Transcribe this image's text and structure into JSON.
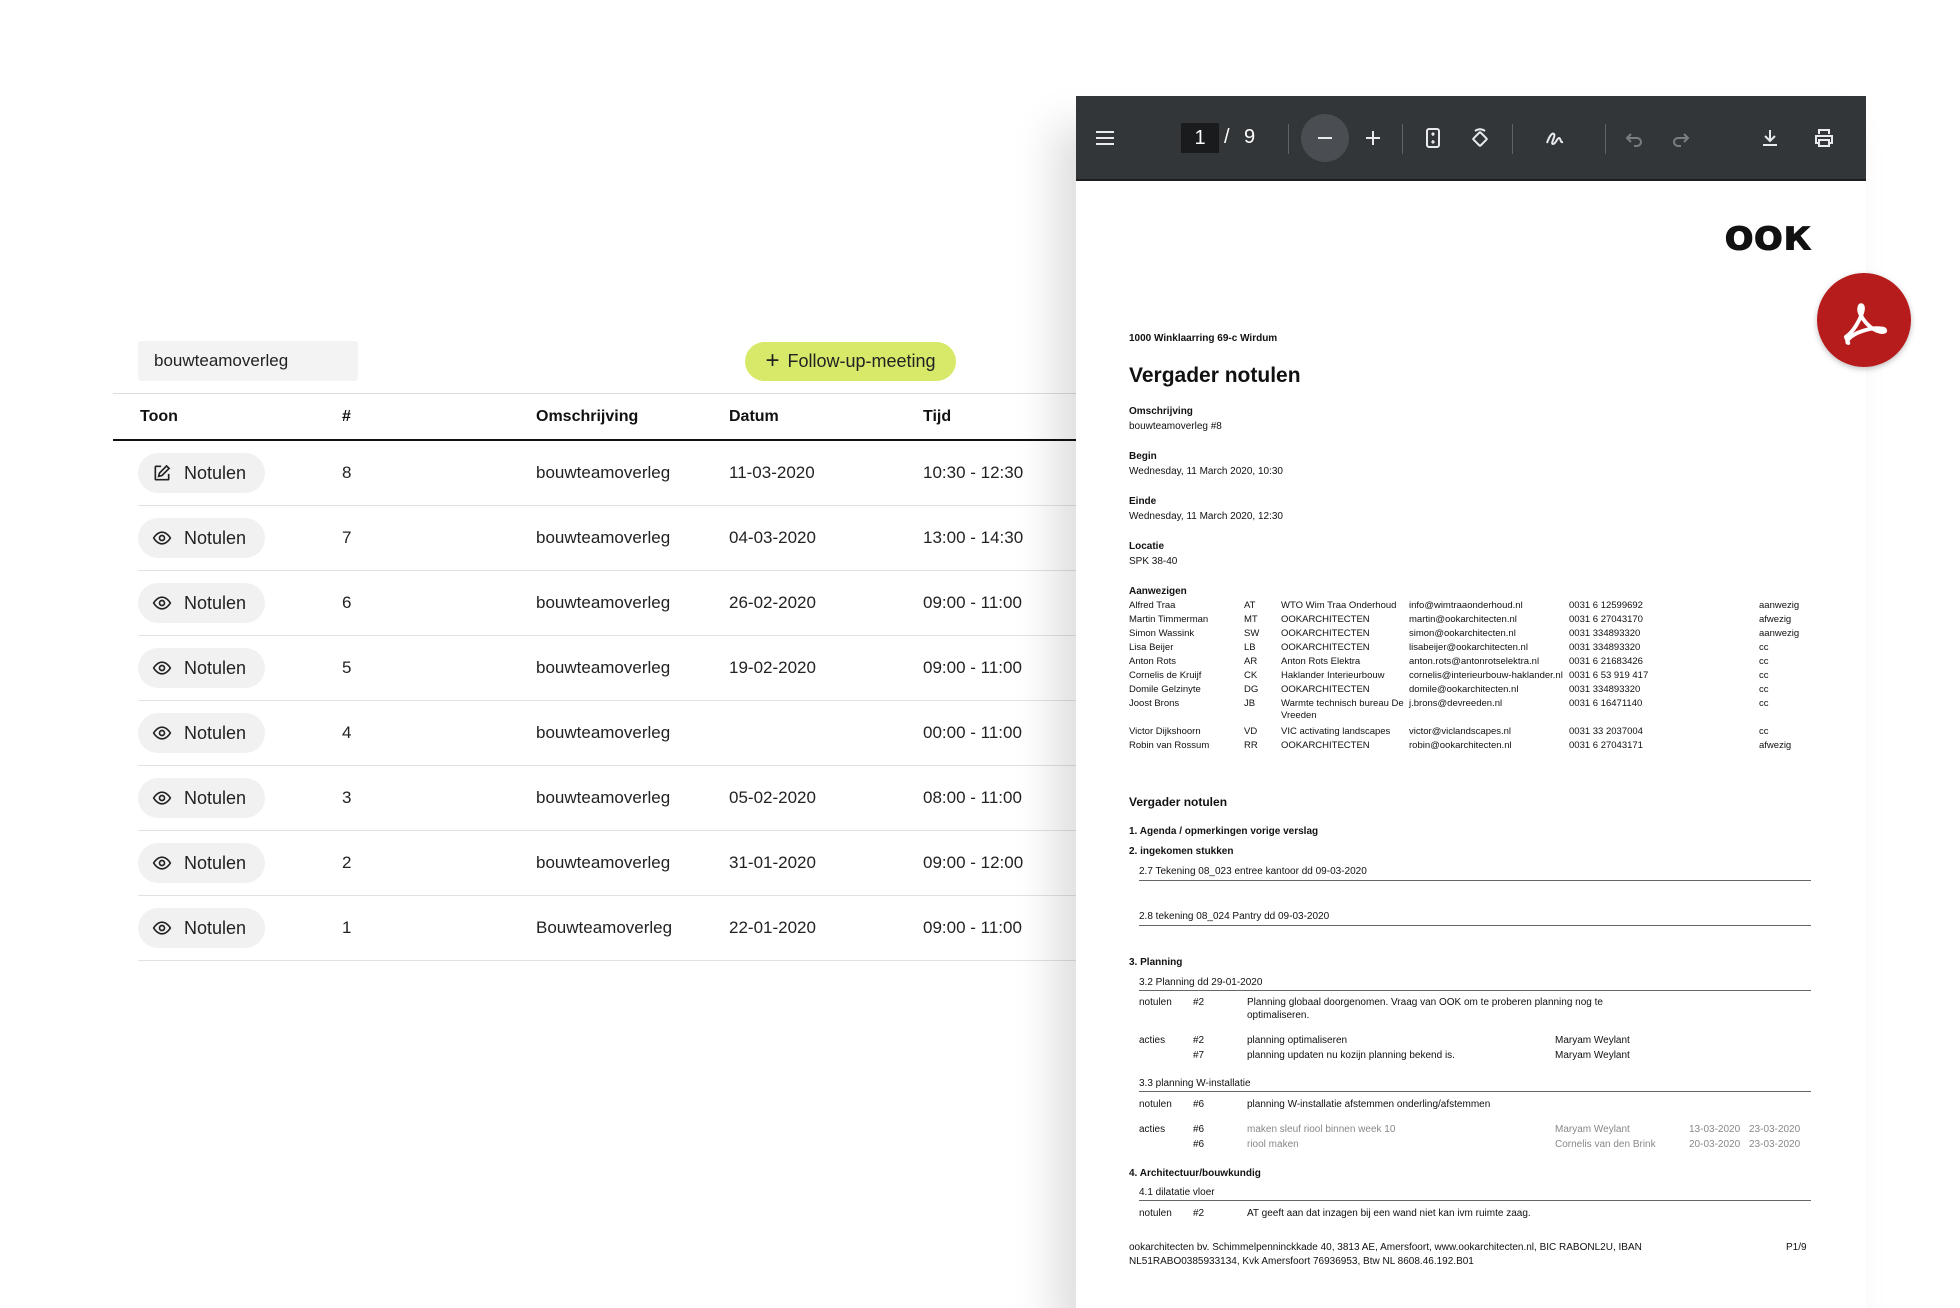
{
  "meeting_list": {
    "filter_value": "bouwteamoverleg",
    "follow_up_label": "Follow-up-meeting",
    "columns": [
      "Toon",
      "#",
      "Omschrijving",
      "Datum",
      "Tijd"
    ],
    "rows": [
      {
        "icon": "edit-icon",
        "toon": "Notulen",
        "nr": "8",
        "omschrijving": "bouwteamoverleg",
        "datum": "11-03-2020",
        "tijd": "10:30 - 12:30"
      },
      {
        "icon": "eye-icon",
        "toon": "Notulen",
        "nr": "7",
        "omschrijving": "bouwteamoverleg",
        "datum": "04-03-2020",
        "tijd": "13:00 - 14:30"
      },
      {
        "icon": "eye-icon",
        "toon": "Notulen",
        "nr": "6",
        "omschrijving": "bouwteamoverleg",
        "datum": "26-02-2020",
        "tijd": "09:00 - 11:00"
      },
      {
        "icon": "eye-icon",
        "toon": "Notulen",
        "nr": "5",
        "omschrijving": "bouwteamoverleg",
        "datum": "19-02-2020",
        "tijd": "09:00 - 11:00"
      },
      {
        "icon": "eye-icon",
        "toon": "Notulen",
        "nr": "4",
        "omschrijving": "bouwteamoverleg",
        "datum": "",
        "tijd": "00:00 - 11:00"
      },
      {
        "icon": "eye-icon",
        "toon": "Notulen",
        "nr": "3",
        "omschrijving": "bouwteamoverleg",
        "datum": "05-02-2020",
        "tijd": "08:00 - 11:00"
      },
      {
        "icon": "eye-icon",
        "toon": "Notulen",
        "nr": "2",
        "omschrijving": "bouwteamoverleg",
        "datum": "31-01-2020",
        "tijd": "09:00 - 12:00"
      },
      {
        "icon": "eye-icon",
        "toon": "Notulen",
        "nr": "1",
        "omschrijving": "Bouwteamoverleg",
        "datum": "22-01-2020",
        "tijd": "09:00 - 11:00"
      }
    ]
  },
  "pdf_viewer": {
    "toolbar": {
      "page_current": "1",
      "page_separator": "/",
      "page_total": "9",
      "icons": [
        "menu-icon",
        "zoom-out-icon",
        "zoom-in-icon",
        "fit-page-icon",
        "rotate-icon",
        "draw-icon",
        "undo-icon",
        "redo-icon",
        "download-icon",
        "print-icon"
      ]
    },
    "logo_text": "ooк",
    "document": {
      "address_line": "1000 Winklaarring 69-c Wirdum",
      "title": "Vergader notulen",
      "fields": [
        {
          "label": "Omschrijving",
          "value": "bouwteamoverleg #8"
        },
        {
          "label": "Begin",
          "value": "Wednesday, 11 March 2020, 10:30"
        },
        {
          "label": "Einde",
          "value": "Wednesday, 11 March 2020, 12:30"
        },
        {
          "label": "Locatie",
          "value": "SPK 38-40"
        }
      ],
      "attendees_label": "Aanwezigen",
      "attendees": [
        {
          "name": "Alfred Traa",
          "code": "AT",
          "company": "WTO Wim Traa Onderhoud",
          "email": "info@wimtraaonderhoud.nl",
          "phone": "0031 6 12599692",
          "status": "aanwezig"
        },
        {
          "name": "Martin Timmerman",
          "code": "MT",
          "company": "OOKARCHITECTEN",
          "email": "martin@ookarchitecten.nl",
          "phone": "0031 6 27043170",
          "status": "afwezig"
        },
        {
          "name": "Simon Wassink",
          "code": "SW",
          "company": "OOKARCHITECTEN",
          "email": "simon@ookarchitecten.nl",
          "phone": "0031 334893320",
          "status": "aanwezig"
        },
        {
          "name": "Lisa Beijer",
          "code": "LB",
          "company": "OOKARCHITECTEN",
          "email": "lisabeijer@ookarchitecten.nl",
          "phone": "0031 334893320",
          "status": "cc"
        },
        {
          "name": "Anton Rots",
          "code": "AR",
          "company": "Anton Rots Elektra",
          "email": "anton.rots@antonrotselektra.nl",
          "phone": "0031 6 21683426",
          "status": "cc"
        },
        {
          "name": "Cornelis de Kruijf",
          "code": "CK",
          "company": "Haklander Interieurbouw",
          "email": "cornelis@interieurbouw-haklander.nl",
          "phone": "0031 6 53 919 417",
          "status": "cc"
        },
        {
          "name": "Domile Gelzinyte",
          "code": "DG",
          "company": "OOKARCHITECTEN",
          "email": "domile@ookarchitecten.nl",
          "phone": "0031 334893320",
          "status": "cc"
        },
        {
          "name": "Joost Brons",
          "code": "JB",
          "company": "Warmte technisch bureau De Vreeden",
          "email": "j.brons@devreeden.nl",
          "phone": "0031 6 16471140",
          "status": "cc"
        },
        {
          "name": "Victor Dijkshoorn",
          "code": "VD",
          "company": "VIC activating landscapes",
          "email": "victor@viclandscapes.nl",
          "phone": "0031 33 2037004",
          "status": "cc"
        },
        {
          "name": "Robin van Rossum",
          "code": "RR",
          "company": "OOKARCHITECTEN",
          "email": "robin@ookarchitecten.nl",
          "phone": "0031 6 27043171",
          "status": "afwezig"
        }
      ],
      "section_title": "Vergader notulen",
      "agenda": {
        "item1": "1. Agenda / opmerkingen vorige verslag",
        "item2": "2. ingekomen stukken",
        "item2_1": "2.7 Tekening 08_023 entree kantoor dd 09-03-2020",
        "item2_2": "2.8 tekening 08_024 Pantry dd 09-03-2020",
        "item3": "3. Planning",
        "item3_1": "3.2 Planning dd 29-01-2020",
        "item3_1_notulen_label": "notulen",
        "item3_1_notulen_nr": "#2",
        "item3_1_notulen_text1": "Planning globaal doorgenomen. Vraag van OOK om te proberen planning nog te",
        "item3_1_notulen_text2": "optimaliseren.",
        "item3_1_acties_label": "acties",
        "item3_1_acties": [
          {
            "nr": "#2",
            "text": "planning optimaliseren",
            "who": "Maryam Weylant"
          },
          {
            "nr": "#7",
            "text": "planning updaten nu kozijn planning bekend is.",
            "who": "Maryam Weylant"
          }
        ],
        "item3_3": "3.3 planning W-installatie",
        "item3_3_notulen_label": "notulen",
        "item3_3_notulen_nr": "#6",
        "item3_3_notulen_text": "planning W-installatie afstemmen onderling/afstemmen",
        "item3_3_acties_label": "acties",
        "item3_3_acties": [
          {
            "nr": "#6",
            "text": "maken sleuf riool binnen week 10",
            "who": "Maryam Weylant",
            "d1": "13-03-2020",
            "d2": "23-03-2020"
          },
          {
            "nr": "#6",
            "text": "riool maken",
            "who": "Cornelis van den Brink",
            "d1": "20-03-2020",
            "d2": "23-03-2020"
          }
        ],
        "item4": "4. Architectuur/bouwkundig",
        "item4_1": "4.1 dilatatie vloer",
        "item4_1_notulen_label": "notulen",
        "item4_1_notulen_nr": "#2",
        "item4_1_notulen_text": "AT geeft aan dat inzagen bij een wand niet kan ivm ruimte zaag."
      },
      "footer_line1": "ookarchitecten bv. Schimmelpenninckkade 40, 3813 AE, Amersfoort, www.ookarchitecten.nl, BIC RABONL2U, IBAN",
      "footer_line2": "NL51RABO0385933134, Kvk Amersfoort 76936953, Btw NL 8608.46.192.B01",
      "footer_page": "P1/9"
    }
  },
  "colors": {
    "accent_green": "#d8e96a",
    "toolbar_bg": "#323639",
    "acrobat_red": "#b71c1c"
  }
}
